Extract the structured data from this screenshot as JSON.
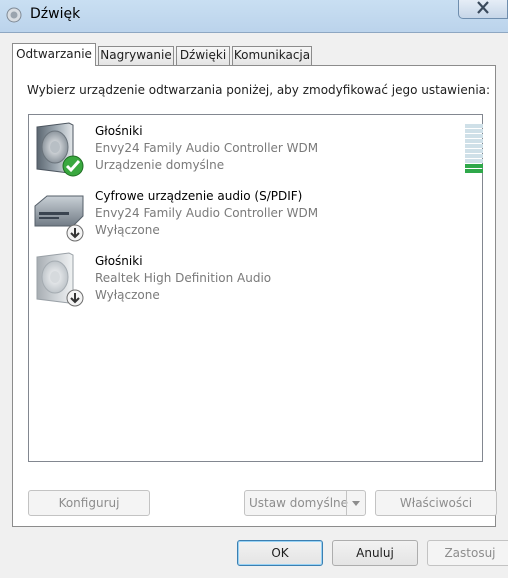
{
  "window": {
    "title": "Dźwięk",
    "icon": "speaker-icon"
  },
  "tabs": [
    {
      "label": "Odtwarzanie",
      "active": true
    },
    {
      "label": "Nagrywanie",
      "active": false
    },
    {
      "label": "Dźwięki",
      "active": false
    },
    {
      "label": "Komunikacja",
      "active": false
    }
  ],
  "instruction": "Wybierz urządzenie odtwarzania poniżej, aby zmodyfikować jego ustawienia:",
  "devices": [
    {
      "name": "Głośniki",
      "driver": "Envy24 Family Audio Controller WDM",
      "status": "Urządzenie domyślne",
      "icon": "speaker-icon",
      "badge": "default-check-icon",
      "level_segments_lit": 2,
      "level_segments_total": 10
    },
    {
      "name": "Cyfrowe urządzenie audio (S/PDIF)",
      "driver": "Envy24 Family Audio Controller WDM",
      "status": "Wyłączone",
      "icon": "digital-audio-device-icon",
      "badge": "disabled-arrow-icon"
    },
    {
      "name": "Głośniki",
      "driver": "Realtek High Definition Audio",
      "status": "Wyłączone",
      "icon": "speaker-icon",
      "badge": "disabled-arrow-icon"
    }
  ],
  "buttons": {
    "configure": "Konfiguruj",
    "set_default": "Ustaw domyślne",
    "properties": "Właściwości",
    "ok": "OK",
    "cancel": "Anuluj",
    "apply": "Zastosuj"
  }
}
